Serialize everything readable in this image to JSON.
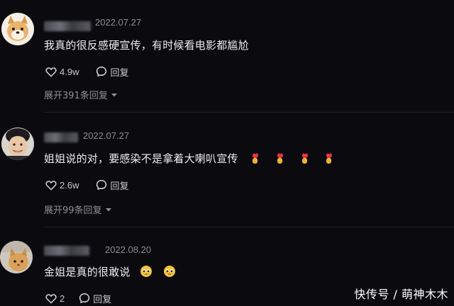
{
  "comments": [
    {
      "username": "搬砖幸福",
      "date": "2022.07.27",
      "text": "我真的很反感硬宣传，有时候看电影都尴尬",
      "likes": "4.9w",
      "reply_label": "回复",
      "expand_label": "展开391条回复",
      "emoji": []
    },
    {
      "username": "",
      "date": "2022.07.27",
      "text": "姐姐说的对，要感染不是拿着大喇叭宣传",
      "likes": "2.6w",
      "reply_label": "回复",
      "expand_label": "展开99条回复",
      "emoji": [
        "finger-heart-icon",
        "finger-heart-icon",
        "finger-heart-icon",
        "finger-heart-icon"
      ]
    },
    {
      "username": "",
      "date": "2022.08.20",
      "text": "金姐是真的很敢说",
      "likes": "2",
      "reply_label": "回复",
      "emoji": [
        "pleading-face-icon",
        "pleading-face-icon"
      ]
    }
  ],
  "watermark": "快传号 / 萌神木木",
  "colors": {
    "background": "#0b0b0f",
    "text": "#ededf1",
    "secondary": "#8a8a92"
  }
}
